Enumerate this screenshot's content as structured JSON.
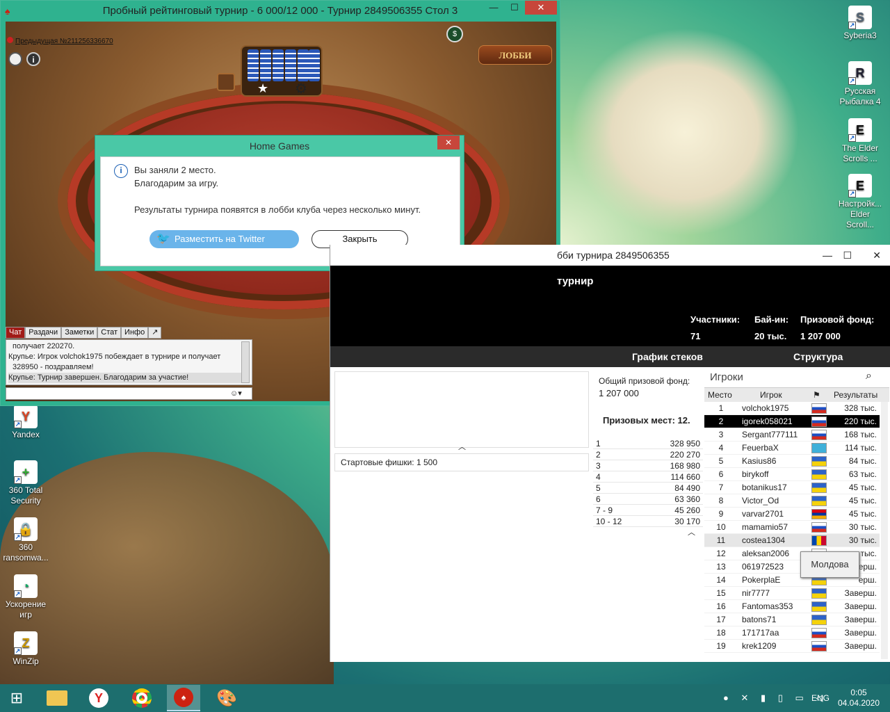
{
  "desktop": {
    "icons_left": [
      {
        "label": "Yandex",
        "icon": "yandex-browser-icon",
        "glyph": "Y",
        "color": "#d42"
      },
      {
        "label": "360 Total Security",
        "icon": "shield-plus-icon",
        "glyph": "+",
        "color": "#3a3"
      },
      {
        "label": "360 ransomwa...",
        "icon": "shield-lock-icon",
        "glyph": "🔒",
        "color": "#36c"
      },
      {
        "label": "Ускорение игр",
        "icon": "speedometer-icon",
        "glyph": "◔",
        "color": "#1a6"
      },
      {
        "label": "WinZip",
        "icon": "winzip-icon",
        "glyph": "Z",
        "color": "#c90"
      }
    ],
    "icons_right": [
      {
        "label": "Syberia3",
        "icon": "syberia-game-icon",
        "glyph": "S",
        "color": "#567"
      },
      {
        "label": "Русская Рыбалка 4",
        "icon": "fishing-game-icon",
        "glyph": "R",
        "color": "#223"
      },
      {
        "label": "The Elder Scrolls ...",
        "icon": "elder-scrolls-icon",
        "glyph": "E",
        "color": "#111"
      },
      {
        "label": "Настройк... Elder Scroll...",
        "icon": "elder-scrolls-settings-icon",
        "glyph": "E",
        "color": "#111"
      }
    ]
  },
  "poker_window": {
    "title": "Пробный рейтинговый турнир - 6 000/12 000 - Турнир 2849506355 Стол 3",
    "prev_hand": "Предыдущая №211256336670",
    "lobby_button": "ЛОББИ",
    "minimize": "—",
    "maximize": "☐",
    "close": "✕",
    "chat_tabs": [
      "Чат",
      "Раздачи",
      "Заметки",
      "Стат",
      "Инфо",
      "↗"
    ],
    "chat_messages": [
      {
        "text": "получает 220270.",
        "indent": true
      },
      {
        "text": "Крупье: Игрок volchok1975 побеждает в турнире и получает",
        "indent": false
      },
      {
        "text": "328950 - поздравляем!",
        "indent": true
      },
      {
        "text": "Крупье: Турнир завершен. Благодарим за участие!",
        "indent": false,
        "highlight": true
      }
    ],
    "chat_input_placeholder": "",
    "emoji": "☺▾"
  },
  "dialog": {
    "title": "Home Games",
    "close": "✕",
    "line1": "Вы заняли 2 место.",
    "line2": "Благодарим за игру.",
    "line3": "Результаты турнира появятся в лобби клуба через несколько минут.",
    "twitter_button": "Разместить на Twitter",
    "close_button": "Закрыть"
  },
  "lobby": {
    "title": "бби турнира 2849506355",
    "heading": "турнир",
    "stats": [
      {
        "label": "Участники:",
        "value": "71"
      },
      {
        "label": "Бай-ин:",
        "value": "20 тыс."
      },
      {
        "label": "Призовой фонд:",
        "value": "1 207 000"
      }
    ],
    "nav": [
      "График стеков",
      "Структура"
    ],
    "start_chips_label": "Стартовые фишки:",
    "start_chips_value": "1 500",
    "prize_pool_label": "Общий призовой фонд:",
    "prize_pool_value": "1 207 000",
    "prize_places": "Призовых мест: 12.",
    "prizes": [
      {
        "place": "1",
        "amount": "328 950"
      },
      {
        "place": "2",
        "amount": "220 270"
      },
      {
        "place": "3",
        "amount": "168 980"
      },
      {
        "place": "4",
        "amount": "114 660"
      },
      {
        "place": "5",
        "amount": "84 490"
      },
      {
        "place": "6",
        "amount": "63 360"
      },
      {
        "place": "7 - 9",
        "amount": "45 260"
      },
      {
        "place": "10 - 12",
        "amount": "30 170"
      }
    ],
    "players_search": "Игроки",
    "columns": {
      "place": "Место",
      "player": "Игрок",
      "result": "Результаты"
    },
    "players": [
      {
        "place": "1",
        "name": "volchok1975",
        "flag": "russia",
        "result": "328 тыс."
      },
      {
        "place": "2",
        "name": "igorek058021",
        "flag": "russia",
        "result": "220 тыс."
      },
      {
        "place": "3",
        "name": "Sergant777111",
        "flag": "russia",
        "result": "168 тыс."
      },
      {
        "place": "4",
        "name": "FeuerbaX",
        "flag": "kazakhstan",
        "result": "114 тыс."
      },
      {
        "place": "5",
        "name": "Kasius86",
        "flag": "ukraine",
        "result": "84 тыс."
      },
      {
        "place": "6",
        "name": "birykoff",
        "flag": "ukraine",
        "result": "63 тыс."
      },
      {
        "place": "7",
        "name": "botanikus17",
        "flag": "ukraine",
        "result": "45 тыс."
      },
      {
        "place": "8",
        "name": "Victor_Od",
        "flag": "ukraine",
        "result": "45 тыс."
      },
      {
        "place": "9",
        "name": "varvar2701",
        "flag": "armenia",
        "result": "45 тыс."
      },
      {
        "place": "10",
        "name": "mamamio57",
        "flag": "russia",
        "result": "30 тыс."
      },
      {
        "place": "11",
        "name": "costea1304",
        "flag": "moldova",
        "result": "30 тыс."
      },
      {
        "place": "12",
        "name": "aleksan2006",
        "flag": "russia",
        "result": "тыс."
      },
      {
        "place": "13",
        "name": "061972523",
        "flag": "ukraine",
        "result": "ерш."
      },
      {
        "place": "14",
        "name": "PokerplaE",
        "flag": "ukraine",
        "result": "ерш."
      },
      {
        "place": "15",
        "name": "nir7777",
        "flag": "ukraine",
        "result": "Заверш."
      },
      {
        "place": "16",
        "name": "Fantomas353",
        "flag": "ukraine",
        "result": "Заверш."
      },
      {
        "place": "17",
        "name": "batons71",
        "flag": "ukraine",
        "result": "Заверш."
      },
      {
        "place": "18",
        "name": "171717aa",
        "flag": "russia",
        "result": "Заверш."
      },
      {
        "place": "19",
        "name": "krek1209",
        "flag": "russia",
        "result": "Заверш."
      }
    ],
    "tooltip": "Молдова"
  },
  "taskbar": {
    "lang": "ENG",
    "time": "0:05",
    "date": "04.04.2020"
  }
}
